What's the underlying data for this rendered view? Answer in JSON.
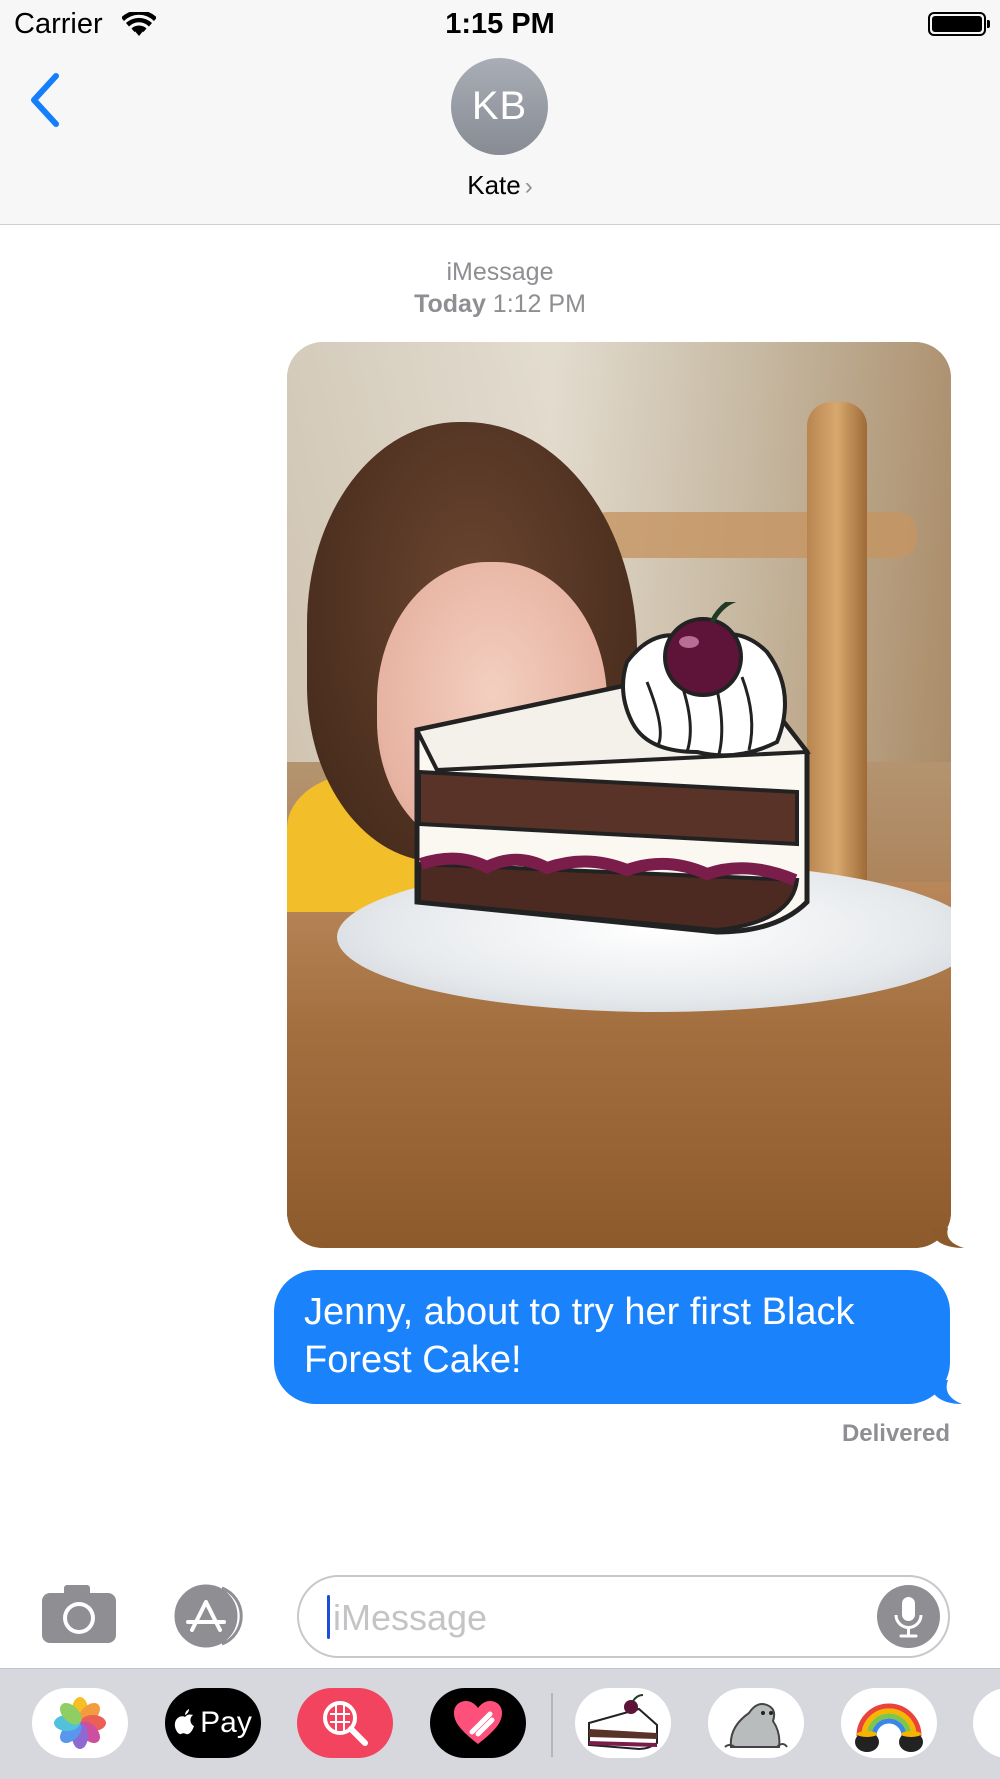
{
  "status_bar": {
    "carrier": "Carrier",
    "time": "1:15 PM"
  },
  "header": {
    "avatar_initials": "KB",
    "contact_name": "Kate",
    "contact_chevron": "›"
  },
  "conversation": {
    "service": "iMessage",
    "timestamp_day": "Today",
    "timestamp_time": "1:12 PM",
    "messages": [
      {
        "type": "photo",
        "description_icon": "photo-sticker-cake"
      },
      {
        "type": "text",
        "text": "Jenny, about to try her first Black Forest Cake!"
      }
    ],
    "status": "Delivered"
  },
  "input_bar": {
    "placeholder": "iMessage"
  },
  "app_drawer": {
    "pay_label": "Pay",
    "apps": [
      "photos-icon",
      "apple-pay-icon",
      "image-search-icon",
      "digital-touch-heart-icon",
      "cake-sticker-icon",
      "seal-sticker-icon",
      "rainbow-sticker-icon",
      "more-sticker-icon"
    ]
  },
  "colors": {
    "accent_blue": "#1a82fb",
    "back_blue": "#147efb",
    "header_bg": "#f7f7f7",
    "drawer_bg": "#d6d8dd"
  }
}
